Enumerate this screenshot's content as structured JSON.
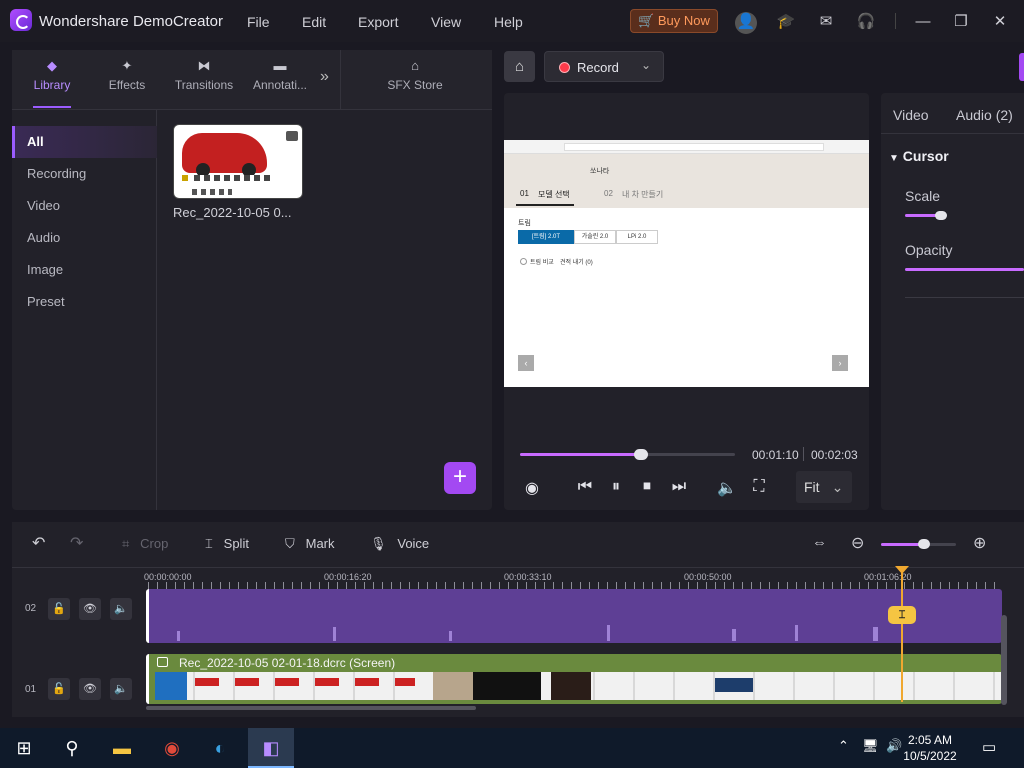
{
  "app": {
    "title": "Wondershare DemoCreator",
    "menus": [
      "File",
      "Edit",
      "Export",
      "View",
      "Help"
    ],
    "buy_now": "Buy Now"
  },
  "library_panel": {
    "tabs": [
      {
        "label": "Library",
        "icon": "layers-icon"
      },
      {
        "label": "Effects",
        "icon": "sparkle-icon"
      },
      {
        "label": "Transitions",
        "icon": "transition-icon"
      },
      {
        "label": "Annotati...",
        "icon": "annotation-icon"
      }
    ],
    "more_tabs_icon": "double-chevron-right-icon",
    "sfx_store": {
      "label": "SFX Store",
      "icon": "store-icon"
    },
    "categories": [
      "All",
      "Recording",
      "Video",
      "Audio",
      "Image",
      "Preset"
    ],
    "selected_category": "All",
    "media": [
      {
        "name": "Rec_2022-10-05 0..."
      }
    ],
    "add_button": "+"
  },
  "record": {
    "label": "Record"
  },
  "preview": {
    "current_time": "00:01:10",
    "total_time": "00:02:03",
    "progress": 0.57,
    "fit": "Fit",
    "screen": {
      "step1_num": "01",
      "step1": "모델 선택",
      "step2_num": "02",
      "step2": "내 차 만들기",
      "trims": [
        "[트림] 2.0T",
        "가솔린 2.0",
        "LPi 2.0"
      ],
      "trim_label": "트림",
      "option": "트림 비교",
      "option2": "견적 내기 (0)",
      "brand": "쏘나타"
    }
  },
  "properties": {
    "tabs": [
      "Video",
      "Audio (2)"
    ],
    "section": "Cursor",
    "scale_label": "Scale",
    "scale_value": 0.3,
    "opacity_label": "Opacity",
    "opacity_value": 1.0
  },
  "timeline": {
    "tools": {
      "crop": "Crop",
      "split": "Split",
      "mark": "Mark",
      "voice": "Voice"
    },
    "ruler": [
      "00:00:00:00",
      "00:00:16:20",
      "00:00:33:10",
      "00:00:50:00",
      "00:01:06:20"
    ],
    "tracks": [
      {
        "number": "02"
      },
      {
        "number": "01",
        "clip_label": "Rec_2022-10-05 02-01-18.dcrc (Screen)"
      }
    ],
    "zoom": 0.55
  },
  "taskbar": {
    "time": "2:05 AM",
    "date": "10/5/2022"
  }
}
